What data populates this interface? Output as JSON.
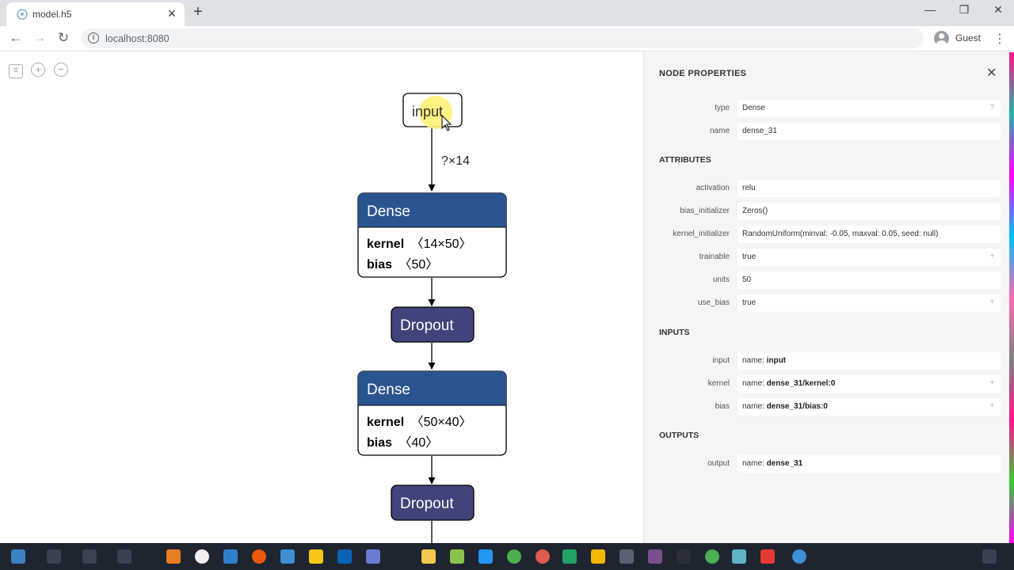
{
  "browser": {
    "tab_title": "model.h5",
    "tab_close": "✕",
    "new_tab": "+",
    "url": "localhost:8080",
    "profile_name": "Guest",
    "minimize": "—",
    "restore": "❐",
    "close": "✕"
  },
  "graph": {
    "input_label": "input",
    "edge_label": "?×14",
    "nodes": [
      {
        "title": "Dense",
        "kernel_key": "kernel",
        "kernel_val": "〈14×50〉",
        "bias_key": "bias",
        "bias_val": "〈50〉"
      },
      {
        "title": "Dropout"
      },
      {
        "title": "Dense",
        "kernel_key": "kernel",
        "kernel_val": "〈50×40〉",
        "bias_key": "bias",
        "bias_val": "〈40〉"
      },
      {
        "title": "Dropout"
      }
    ],
    "colors": {
      "dense": "#2a5490",
      "dropout": "#41447a",
      "highlight": "#fff176"
    }
  },
  "sidebar": {
    "title": "NODE PROPERTIES",
    "close": "✕",
    "properties": [
      {
        "label": "type",
        "value": "Dense",
        "extra": "?"
      },
      {
        "label": "name",
        "value": "dense_31"
      }
    ],
    "attributes_title": "ATTRIBUTES",
    "attributes": [
      {
        "label": "activation",
        "value": "relu"
      },
      {
        "label": "bias_initializer",
        "value": "Zeros()"
      },
      {
        "label": "kernel_initializer",
        "value": "RandomUniform(minval: -0.05, maxval: 0.05, seed: null)"
      },
      {
        "label": "trainable",
        "value": "true",
        "extra": "+"
      },
      {
        "label": "units",
        "value": "50"
      },
      {
        "label": "use_bias",
        "value": "true",
        "extra": "+"
      }
    ],
    "inputs_title": "INPUTS",
    "inputs": [
      {
        "label": "input",
        "prefix": "name: ",
        "value": "input"
      },
      {
        "label": "kernel",
        "prefix": "name: ",
        "value": "dense_31/kernel:0",
        "extra": "+"
      },
      {
        "label": "bias",
        "prefix": "name: ",
        "value": "dense_31/bias:0",
        "extra": "+"
      }
    ],
    "outputs_title": "OUTPUTS",
    "outputs": [
      {
        "label": "output",
        "prefix": "name: ",
        "value": "dense_31"
      }
    ]
  }
}
